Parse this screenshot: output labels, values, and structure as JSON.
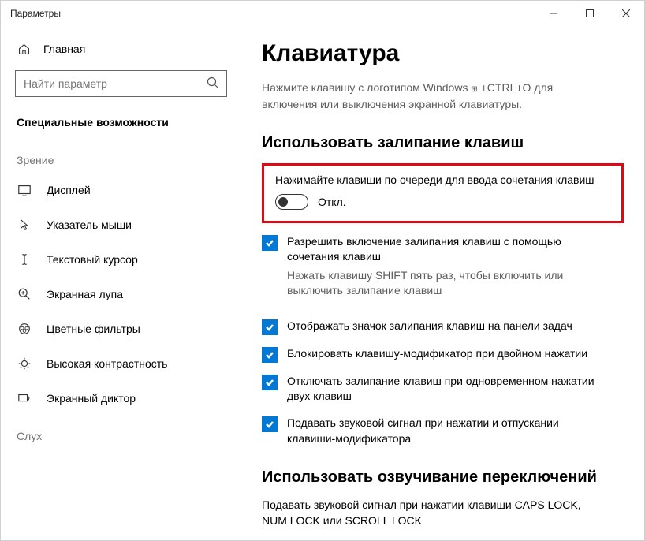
{
  "window": {
    "title": "Параметры"
  },
  "sidebar": {
    "home": "Главная",
    "search_placeholder": "Найти параметр",
    "category": "Специальные возможности",
    "group_vision": "Зрение",
    "group_hearing": "Слух",
    "items": {
      "display": "Дисплей",
      "cursor": "Указатель мыши",
      "textcursor": "Текстовый курсор",
      "magnifier": "Экранная лупа",
      "colorfilters": "Цветные фильтры",
      "highcontrast": "Высокая контрастность",
      "narrator": "Экранный диктор"
    }
  },
  "content": {
    "title": "Клавиатура",
    "intro_a": "Нажмите клавишу с логотипом Windows ",
    "intro_b": " +CTRL+O для включения или выключения экранной клавиатуры.",
    "sticky": {
      "heading": "Использовать залипание клавиш",
      "toggle_label": "Нажимайте клавиши по очереди для ввода сочетания клавиш",
      "toggle_state": "Откл.",
      "allow_shortcut": "Разрешить включение залипания клавиш с помощью сочетания клавиш",
      "allow_shortcut_sub": "Нажать клавишу SHIFT пять раз, чтобы включить или выключить залипание клавиш",
      "show_icon": "Отображать значок залипания клавиш на панели задач",
      "lock_modifier": "Блокировать клавишу-модификатор при двойном нажатии",
      "turn_off_two": "Отключать залипание клавиш при одновременном нажатии двух клавиш",
      "sound": "Подавать звуковой сигнал при нажатии и отпускании клавиши-модификатора"
    },
    "togglekeys": {
      "heading": "Использовать озвучивание переключений",
      "desc": "Подавать звуковой сигнал при нажатии клавиши CAPS LOCK, NUM LOCK или SCROLL LOCK"
    }
  }
}
